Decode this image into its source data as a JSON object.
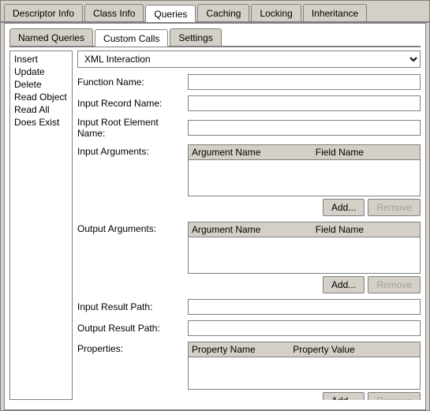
{
  "topTabs": {
    "items": [
      {
        "label": "Descriptor Info",
        "active": false
      },
      {
        "label": "Class Info",
        "active": false
      },
      {
        "label": "Queries",
        "active": true
      },
      {
        "label": "Caching",
        "active": false
      },
      {
        "label": "Locking",
        "active": false
      },
      {
        "label": "Inheritance",
        "active": false
      }
    ]
  },
  "secondTabs": {
    "items": [
      {
        "label": "Named Queries",
        "active": false
      },
      {
        "label": "Custom Calls",
        "active": true
      },
      {
        "label": "Settings",
        "active": false
      }
    ]
  },
  "leftPanel": {
    "items": [
      {
        "label": "Insert"
      },
      {
        "label": "Update"
      },
      {
        "label": "Delete"
      },
      {
        "label": "Read Object"
      },
      {
        "label": "Read All"
      },
      {
        "label": "Does Exist"
      }
    ]
  },
  "dropdown": {
    "value": "XML Interaction",
    "options": [
      "XML Interaction"
    ]
  },
  "form": {
    "functionNameLabel": "Function Name:",
    "functionNameValue": "",
    "inputRecordNameLabel": "Input Record Name:",
    "inputRecordNameValue": "",
    "inputRootElementNameLabel": "Input Root Element Name:",
    "inputRootElementNameValue": ""
  },
  "inputArguments": {
    "label": "Input Arguments:",
    "columns": [
      "Argument Name",
      "Field Name"
    ],
    "addLabel": "Add...",
    "removeLabel": "Remove"
  },
  "outputArguments": {
    "label": "Output Arguments:",
    "columns": [
      "Argument Name",
      "Field Name"
    ],
    "addLabel": "Add...",
    "removeLabel": "Remove"
  },
  "resultPaths": {
    "inputResultPathLabel": "Input Result Path:",
    "inputResultPathValue": "",
    "outputResultPathLabel": "Output Result Path:",
    "outputResultPathValue": ""
  },
  "properties": {
    "label": "Properties:",
    "columns": [
      "Property Name",
      "Property Value"
    ],
    "addLabel": "Add...",
    "removeLabel": "Remove"
  }
}
